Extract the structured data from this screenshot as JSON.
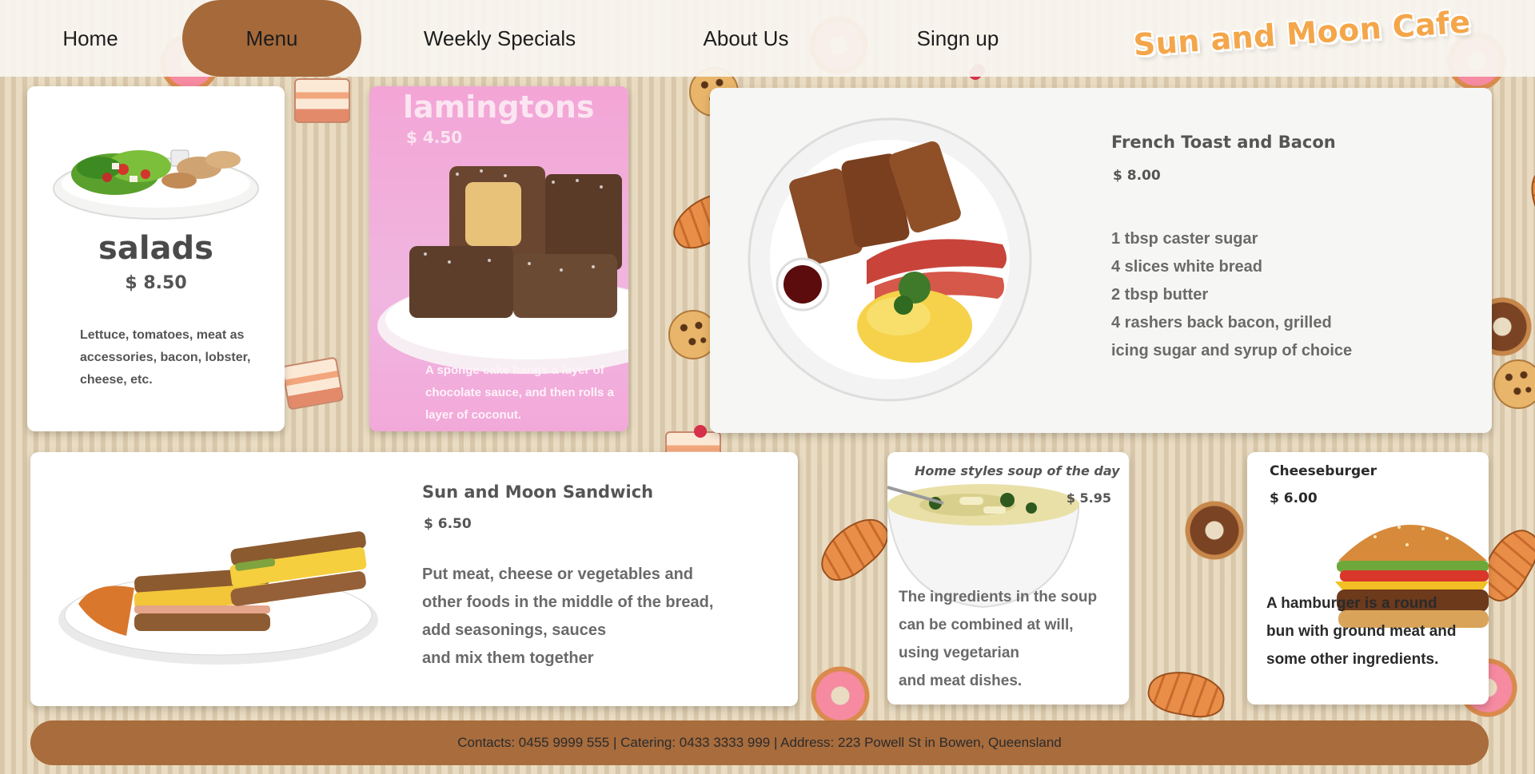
{
  "nav": {
    "items": [
      {
        "label": "Home",
        "active": false
      },
      {
        "label": "Menu",
        "active": true
      },
      {
        "label": "Weekly Specials",
        "active": false
      },
      {
        "label": "About Us",
        "active": false
      },
      {
        "label": "Singn up",
        "active": false
      }
    ],
    "logo_text": "Sun and Moon Cafe"
  },
  "cards": {
    "salads": {
      "title": "salads",
      "price": "$ 8.50",
      "description": "Lettuce, tomatoes, meat as accessories, bacon, lobster, cheese, etc."
    },
    "lamingtons": {
      "title": "lamingtons",
      "price": "$ 4.50",
      "description": "A sponge cake hangs a layer of chocolate sauce, and then rolls a layer of coconut."
    },
    "french_toast": {
      "title": "French Toast and Bacon",
      "price": "$ 8.00",
      "ingredients": [
        "1 tbsp caster sugar",
        "4 slices white bread",
        "2 tbsp butter",
        "4 rashers back bacon, grilled",
        "icing sugar and syrup of choice"
      ]
    },
    "sandwich": {
      "title": "Sun and Moon Sandwich",
      "price": "$ 6.50",
      "lines": [
        "Put meat, cheese or vegetables and",
        "other foods in the middle of the bread,",
        "add seasonings, sauces",
        "and mix them together"
      ]
    },
    "soup": {
      "title": "Home styles soup of the day",
      "price": "$ 5.95",
      "lines": [
        "The ingredients in the soup",
        "can be combined at will,",
        "using vegetarian",
        "and meat dishes."
      ]
    },
    "cheeseburger": {
      "title": "Cheeseburger",
      "price": "$ 6.00",
      "lines": [
        "A hamburger is a round",
        "bun with ground meat and",
        "some other ingredients."
      ]
    }
  },
  "footer": {
    "text": "Contacts: 0455 9999 555 | Catering: 0433 3333 999 | Address: 223 Powell St in Bowen, Queensland"
  },
  "colors": {
    "accent": "#a5693a",
    "logo": "#f4a64a",
    "background": "#e9dcc2",
    "lamington_bg": "#f3a5d6"
  },
  "icons": [
    "salad-image",
    "lamington-image",
    "french-toast-image",
    "sandwich-image",
    "soup-image",
    "cheeseburger-image",
    "logo-image"
  ]
}
